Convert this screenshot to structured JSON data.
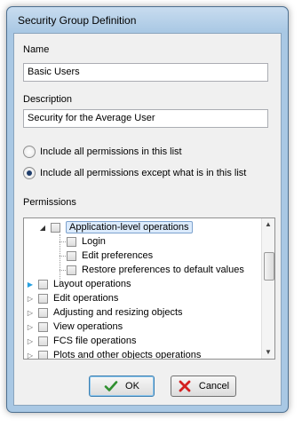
{
  "dialog": {
    "title": "Security Group Definition"
  },
  "name_field": {
    "label": "Name",
    "value": "Basic Users"
  },
  "description_field": {
    "label": "Description",
    "value": "Security for the Average User"
  },
  "options": [
    {
      "label": "Include all permissions in this list",
      "checked": false
    },
    {
      "label": "Include all permissions except what is in this list",
      "checked": true
    }
  ],
  "permissions": {
    "label": "Permissions",
    "items": [
      {
        "label": "Application-level operations",
        "state": "expanded",
        "selected": true
      },
      {
        "label": "Login",
        "child": true
      },
      {
        "label": "Edit preferences",
        "child": true
      },
      {
        "label": "Restore preferences to default values",
        "child": true
      },
      {
        "label": "Layout operations",
        "state": "collapsed-hover"
      },
      {
        "label": "Edit operations",
        "state": "collapsed"
      },
      {
        "label": "Adjusting and resizing objects",
        "state": "collapsed"
      },
      {
        "label": "View operations",
        "state": "collapsed"
      },
      {
        "label": "FCS file operations",
        "state": "collapsed"
      },
      {
        "label": "Plots and other objects operations",
        "state": "collapsed"
      }
    ]
  },
  "buttons": {
    "ok": "OK",
    "cancel": "Cancel"
  },
  "colors": {
    "ok_check": "#2f8f2f",
    "cancel_x": "#d42020",
    "selection": "#dcebfc"
  }
}
